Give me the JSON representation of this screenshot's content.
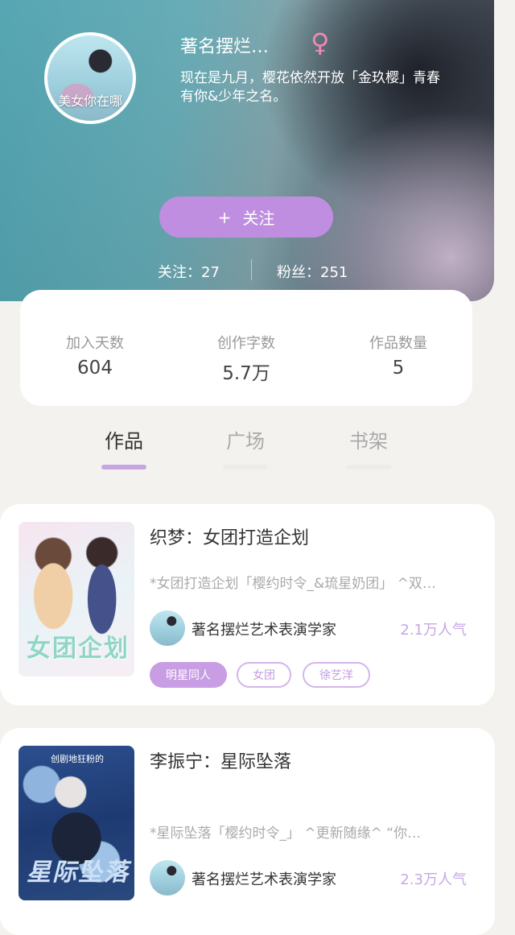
{
  "profile": {
    "avatar_caption": "美女你在哪",
    "username": "著名摆烂…",
    "gender_symbol": "♀",
    "bio": "现在是九月，樱花依然开放「金玖樱」青春有你&少年之名。",
    "follow_icon": "+",
    "follow_label": "关注",
    "following_text": "关注：27",
    "fans_text": "粉丝：251"
  },
  "stats": [
    {
      "label": "加入天数",
      "value": "604"
    },
    {
      "label": "创作字数",
      "value": "5.7万"
    },
    {
      "label": "作品数量",
      "value": "5"
    }
  ],
  "tabs": [
    {
      "label": "作品",
      "active": true
    },
    {
      "label": "广场",
      "active": false
    },
    {
      "label": "书架",
      "active": false
    }
  ],
  "works": [
    {
      "cover_text": "女团企划",
      "title": "织梦：女团打造企划",
      "description": "*女团打造企划「樱约时令_&琉星奶团」 ^双…",
      "author": "著名摆烂艺术表演学家",
      "popularity": "2.1万人气",
      "tags": [
        "明星同人",
        "女团",
        "徐艺洋"
      ]
    },
    {
      "cover_top": "创剧地狂粉的",
      "cover_text": "星际坠落",
      "title": "李振宁：星际坠落",
      "description": "*星际坠落「樱约时令_」 ^更新随缘^ “你…",
      "author": "著名摆烂艺术表演学家",
      "popularity": "2.3万人气"
    }
  ],
  "colors": {
    "accent": "#c08ee0",
    "accent_light": "#c8a6e6",
    "gender": "#f08ab6",
    "background": "#f3f2ee"
  }
}
